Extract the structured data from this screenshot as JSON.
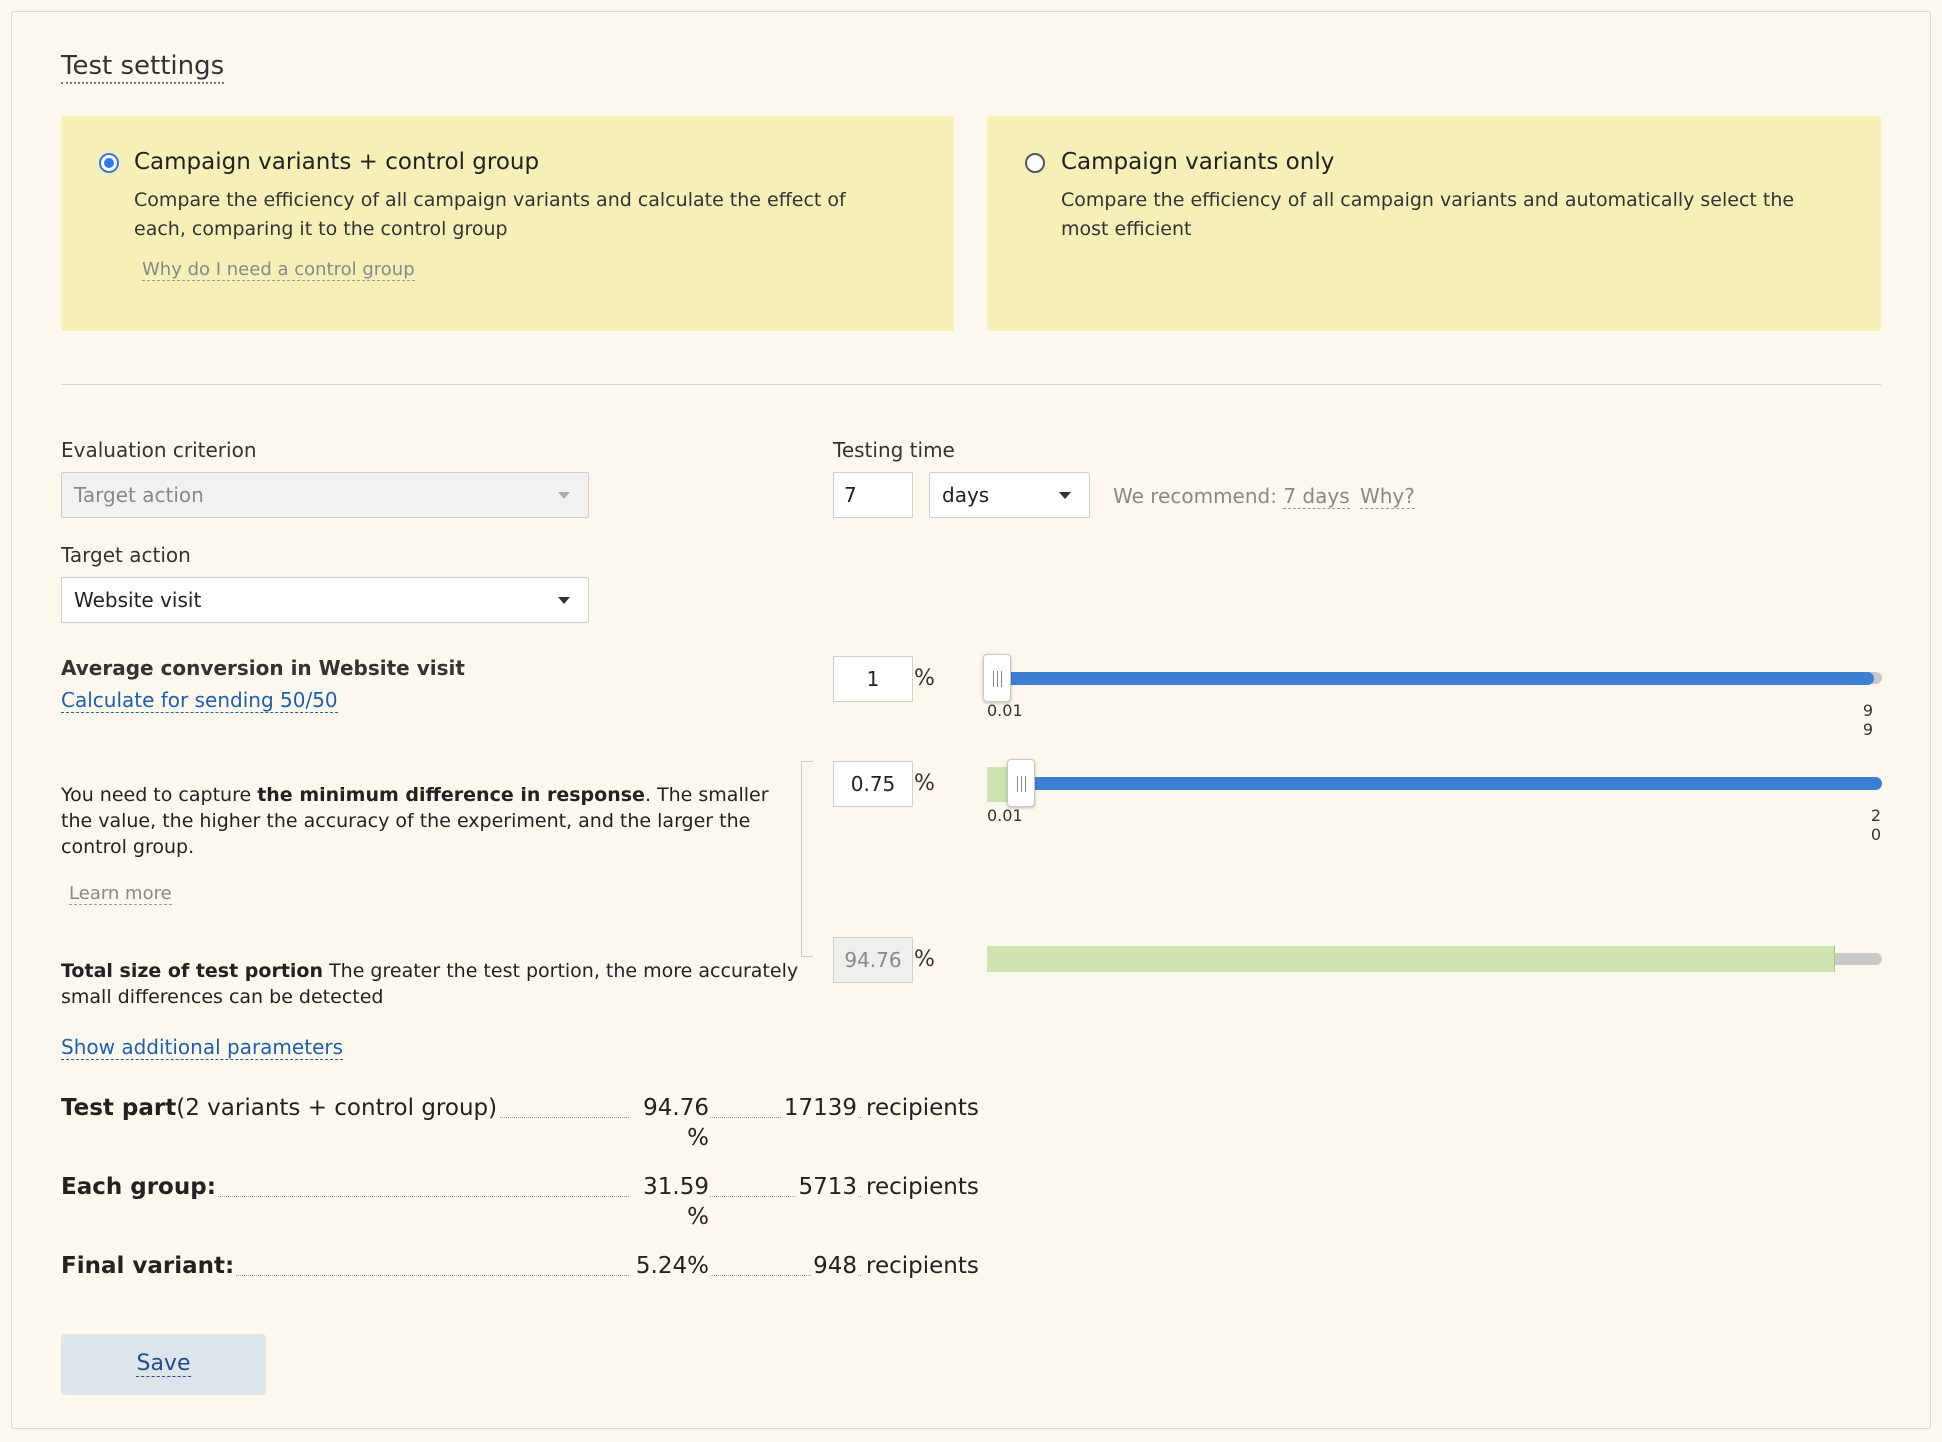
{
  "title": "Test settings",
  "options": [
    {
      "title": "Campaign variants + control group",
      "description": "Compare the efficiency of all campaign variants and calculate the effect of each, comparing it to the control group",
      "link": "Why do I need a control group",
      "checked": true
    },
    {
      "title": "Campaign variants only",
      "description": "Compare the efficiency of all campaign variants and automatically select the most efficient",
      "checked": false
    }
  ],
  "evaluation": {
    "label": "Evaluation criterion",
    "value": "Target action"
  },
  "target_action": {
    "label": "Target action",
    "value": "Website visit"
  },
  "testing_time": {
    "label": "Testing time",
    "value": "7",
    "unit": "days",
    "recommend_label": "We recommend:",
    "recommend_value": "7 days",
    "why": "Why?"
  },
  "conversion": {
    "label": "Average conversion in Website visit",
    "calc_link": "Calculate for sending 50/50",
    "value": "1",
    "unit": "%",
    "min": "0.01",
    "max_line1": "9",
    "max_line2": "9",
    "level_fraction": 0.0
  },
  "min_difference": {
    "text_pre": "You need to capture ",
    "text_bold": "the minimum difference in response",
    "text_post": ". The smaller the value, the higher the accuracy of the experiment, and the larger the control group.",
    "learn_more": "Learn more",
    "value": "0.75",
    "unit": "%",
    "min": "0.01",
    "max_line1": "2",
    "max_line2": "0",
    "level_fraction": 0.037
  },
  "test_portion": {
    "label_bold": "Total size of test portion",
    "label_rest": " The greater the test portion, the more accurately small differences can be detected",
    "value": "94.76",
    "unit": "%",
    "level_percent": 94.76
  },
  "show_params_link": "Show additional parameters",
  "summary": [
    {
      "label_bold": "Test part",
      "label_rest": "(2 variants + control group)",
      "pct_line1": "94.76",
      "pct_line2": "%",
      "count": "17139",
      "unit": "recipients"
    },
    {
      "label_bold": "Each group:",
      "label_rest": "",
      "pct_line1": "31.59",
      "pct_line2": "%",
      "count": "5713",
      "unit": "recipients"
    },
    {
      "label_bold": "Final variant:",
      "label_rest": "",
      "pct_line1": "5.24%",
      "pct_line2": "",
      "count": "948",
      "unit": "recipients"
    }
  ],
  "save_label": "Save",
  "colors": {
    "background": "#fdf8ee",
    "option_card": "#f5f0b8",
    "slider_blue": "#3f7fd3",
    "slider_green": "#cfe4b0",
    "radio_checked": "#2f78e6",
    "link": "#1f5fa8"
  }
}
